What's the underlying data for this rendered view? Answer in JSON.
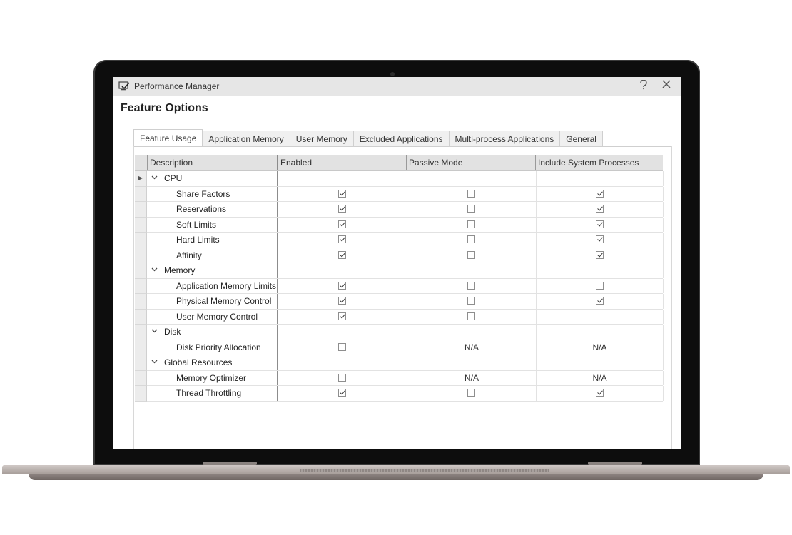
{
  "window": {
    "title": "Performance Manager",
    "heading": "Feature Options",
    "icons": {
      "app": "monitor-check-icon",
      "help": "help-icon",
      "close": "close-icon"
    }
  },
  "tabs": [
    {
      "label": "Feature Usage",
      "active": true
    },
    {
      "label": "Application Memory",
      "active": false
    },
    {
      "label": "User Memory",
      "active": false
    },
    {
      "label": "Excluded Applications",
      "active": false
    },
    {
      "label": "Multi-process Applications",
      "active": false
    },
    {
      "label": "General",
      "active": false
    }
  ],
  "grid": {
    "columns": [
      "Description",
      "Enabled",
      "Passive Mode",
      "Include System Processes"
    ],
    "rows": [
      {
        "type": "group",
        "label": "CPU"
      },
      {
        "type": "item",
        "label": "Share Factors",
        "enabled": true,
        "passive": false,
        "system": true
      },
      {
        "type": "item",
        "label": "Reservations",
        "enabled": true,
        "passive": false,
        "system": true
      },
      {
        "type": "item",
        "label": "Soft Limits",
        "enabled": true,
        "passive": false,
        "system": true
      },
      {
        "type": "item",
        "label": "Hard Limits",
        "enabled": true,
        "passive": false,
        "system": true
      },
      {
        "type": "item",
        "label": "Affinity",
        "enabled": true,
        "passive": false,
        "system": true
      },
      {
        "type": "group",
        "label": "Memory"
      },
      {
        "type": "item",
        "label": "Application Memory Limits",
        "enabled": true,
        "passive": false,
        "system": false
      },
      {
        "type": "item",
        "label": "Physical Memory Control",
        "enabled": true,
        "passive": false,
        "system": true
      },
      {
        "type": "item",
        "label": "User Memory Control",
        "enabled": true,
        "passive": false,
        "system": null
      },
      {
        "type": "group",
        "label": "Disk"
      },
      {
        "type": "item",
        "label": "Disk Priority Allocation",
        "enabled": false,
        "passive": "N/A",
        "system": "N/A"
      },
      {
        "type": "group",
        "label": "Global Resources"
      },
      {
        "type": "item",
        "label": "Memory Optimizer",
        "enabled": false,
        "passive": "N/A",
        "system": "N/A"
      },
      {
        "type": "item",
        "label": "Thread Throttling",
        "enabled": true,
        "passive": false,
        "system": true
      }
    ]
  }
}
